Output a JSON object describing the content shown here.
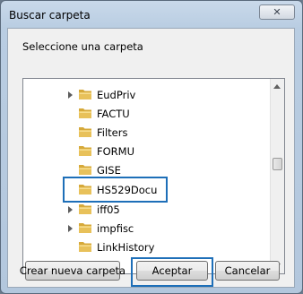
{
  "dialog": {
    "title": "Buscar carpeta",
    "close_icon": "close-icon",
    "instructions": "Seleccione una carpeta"
  },
  "tree": {
    "items": [
      {
        "label": "EudPriv",
        "expandable": true
      },
      {
        "label": "FACTU",
        "expandable": false
      },
      {
        "label": "Filters",
        "expandable": false
      },
      {
        "label": "FORMU",
        "expandable": false
      },
      {
        "label": "GISE",
        "expandable": false
      },
      {
        "label": "HS529Docu",
        "expandable": false,
        "selected": true
      },
      {
        "label": "iff05",
        "expandable": true
      },
      {
        "label": "impfisc",
        "expandable": true
      },
      {
        "label": "LinkHistory",
        "expandable": false
      }
    ],
    "scroll_fraction": 0.42
  },
  "buttons": {
    "new_folder": "Crear nueva carpeta",
    "ok": "Aceptar",
    "cancel": "Cancelar"
  },
  "colors": {
    "highlight": "#1e6fb8",
    "folder": "#e8c15a"
  }
}
